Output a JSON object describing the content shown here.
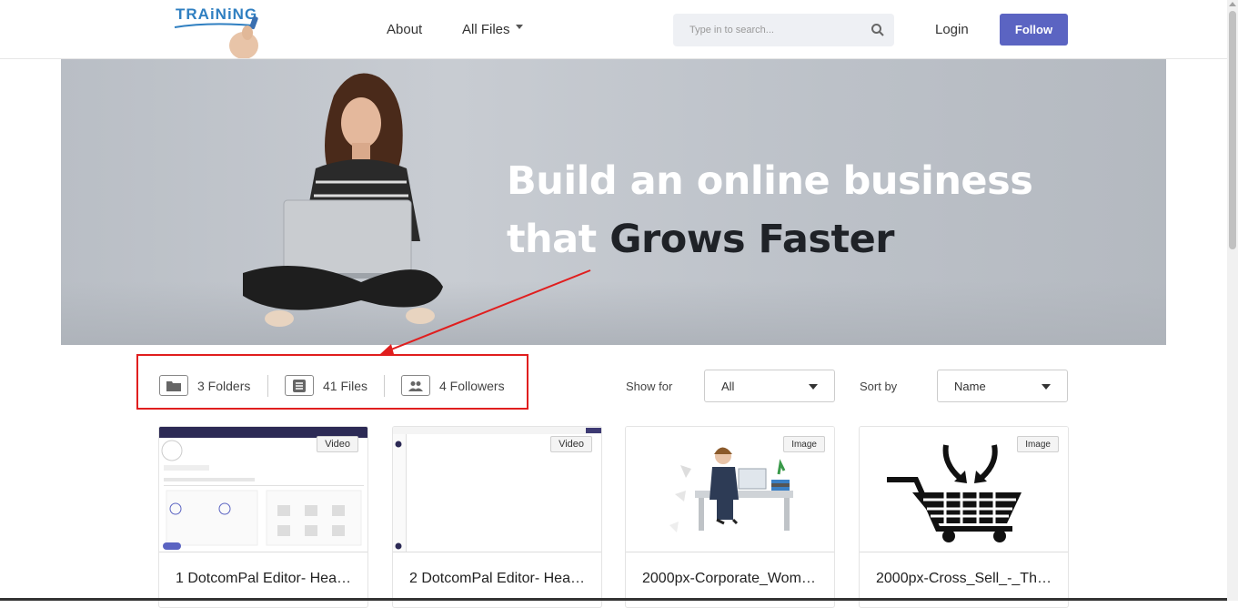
{
  "header": {
    "logo_text": "TRAiNiNG",
    "nav_about": "About",
    "nav_all_files": "All Files",
    "search_placeholder": "Type in to search...",
    "login": "Login",
    "follow": "Follow"
  },
  "banner": {
    "title_line1": "Build an online business",
    "title_line2_a": "that ",
    "title_line2_b": "Grows Faster"
  },
  "stats": {
    "folders": "3 Folders",
    "files": "41 Files",
    "followers": "4 Followers"
  },
  "filters": {
    "show_for_label": "Show for",
    "show_for_value": "All",
    "sort_by_label": "Sort by",
    "sort_by_value": "Name"
  },
  "cards": [
    {
      "title": "1 DotcomPal Editor- Hea…",
      "badge": "Video"
    },
    {
      "title": "2 DotcomPal Editor- Hea…",
      "badge": "Video"
    },
    {
      "title": "2000px-Corporate_Wom…",
      "badge": "Image"
    },
    {
      "title": "2000px-Cross_Sell_-_Th…",
      "badge": "Image"
    }
  ],
  "colors": {
    "accent": "#5b64c2",
    "highlight": "#e01e1e"
  }
}
